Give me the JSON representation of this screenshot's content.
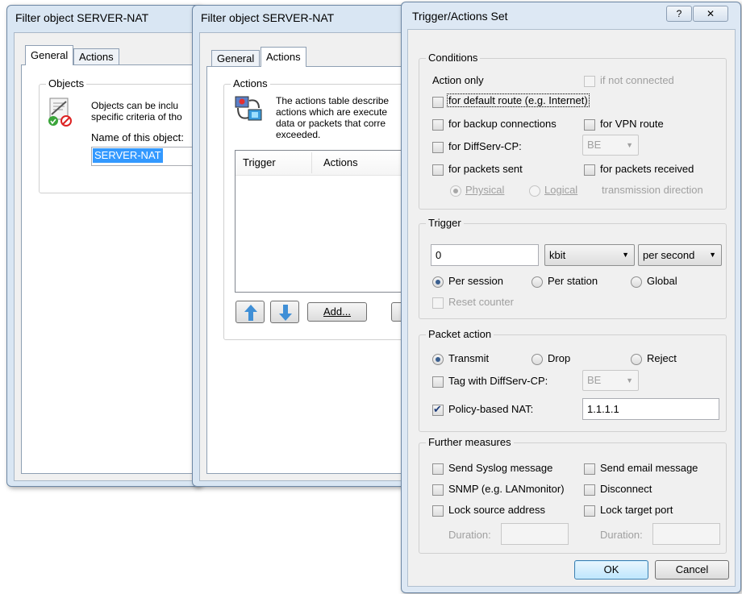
{
  "window1": {
    "title": "Filter object SERVER-NAT",
    "tabs": [
      "General",
      "Actions"
    ],
    "objects_group": "Objects",
    "desc_line1": "Objects can be inclu",
    "desc_line2": "specific criteria of tho",
    "name_label": "Name of this object:",
    "name_value": "SERVER-NAT"
  },
  "window2": {
    "title": "Filter object SERVER-NAT",
    "tabs": [
      "General",
      "Actions"
    ],
    "actions_group": "Actions",
    "desc_lines": [
      "The actions table describe",
      "actions which are execute",
      "data or packets that corre",
      "exceeded."
    ],
    "columns": [
      "Trigger",
      "Actions"
    ],
    "add_button": "Add..."
  },
  "dialog": {
    "title": "Trigger/Actions Set",
    "help_glyph": "?",
    "close_glyph": "✕",
    "conditions": {
      "legend": "Conditions",
      "action_only": "Action only",
      "if_not_connected": "if not connected",
      "default_route": "for default route (e.g. Internet)",
      "backup": "for backup connections",
      "vpn_route": "for VPN route",
      "diffserv": "for DiffServ-CP:",
      "diffserv_value": "BE",
      "packets_sent": "for packets sent",
      "packets_received": "for packets received",
      "physical": "Physical",
      "logical": "Logical",
      "transmission_direction": "transmission direction"
    },
    "trigger": {
      "legend": "Trigger",
      "value": "0",
      "unit": "kbit",
      "period": "per second",
      "per_session": "Per session",
      "per_station": "Per station",
      "global": "Global",
      "reset_counter": "Reset counter"
    },
    "packet_action": {
      "legend": "Packet action",
      "transmit": "Transmit",
      "drop": "Drop",
      "reject": "Reject",
      "tag_diffserv": "Tag with DiffServ-CP:",
      "tag_value": "BE",
      "policy_nat": "Policy-based NAT:",
      "policy_nat_value": "1.1.1.1"
    },
    "further": {
      "legend": "Further measures",
      "syslog": "Send Syslog message",
      "email": "Send email message",
      "snmp": "SNMP (e.g. LANmonitor)",
      "disconnect": "Disconnect",
      "lock_source": "Lock source address",
      "lock_target": "Lock target port",
      "duration1": "Duration:",
      "duration2": "Duration:"
    },
    "ok": "OK",
    "cancel": "Cancel"
  }
}
